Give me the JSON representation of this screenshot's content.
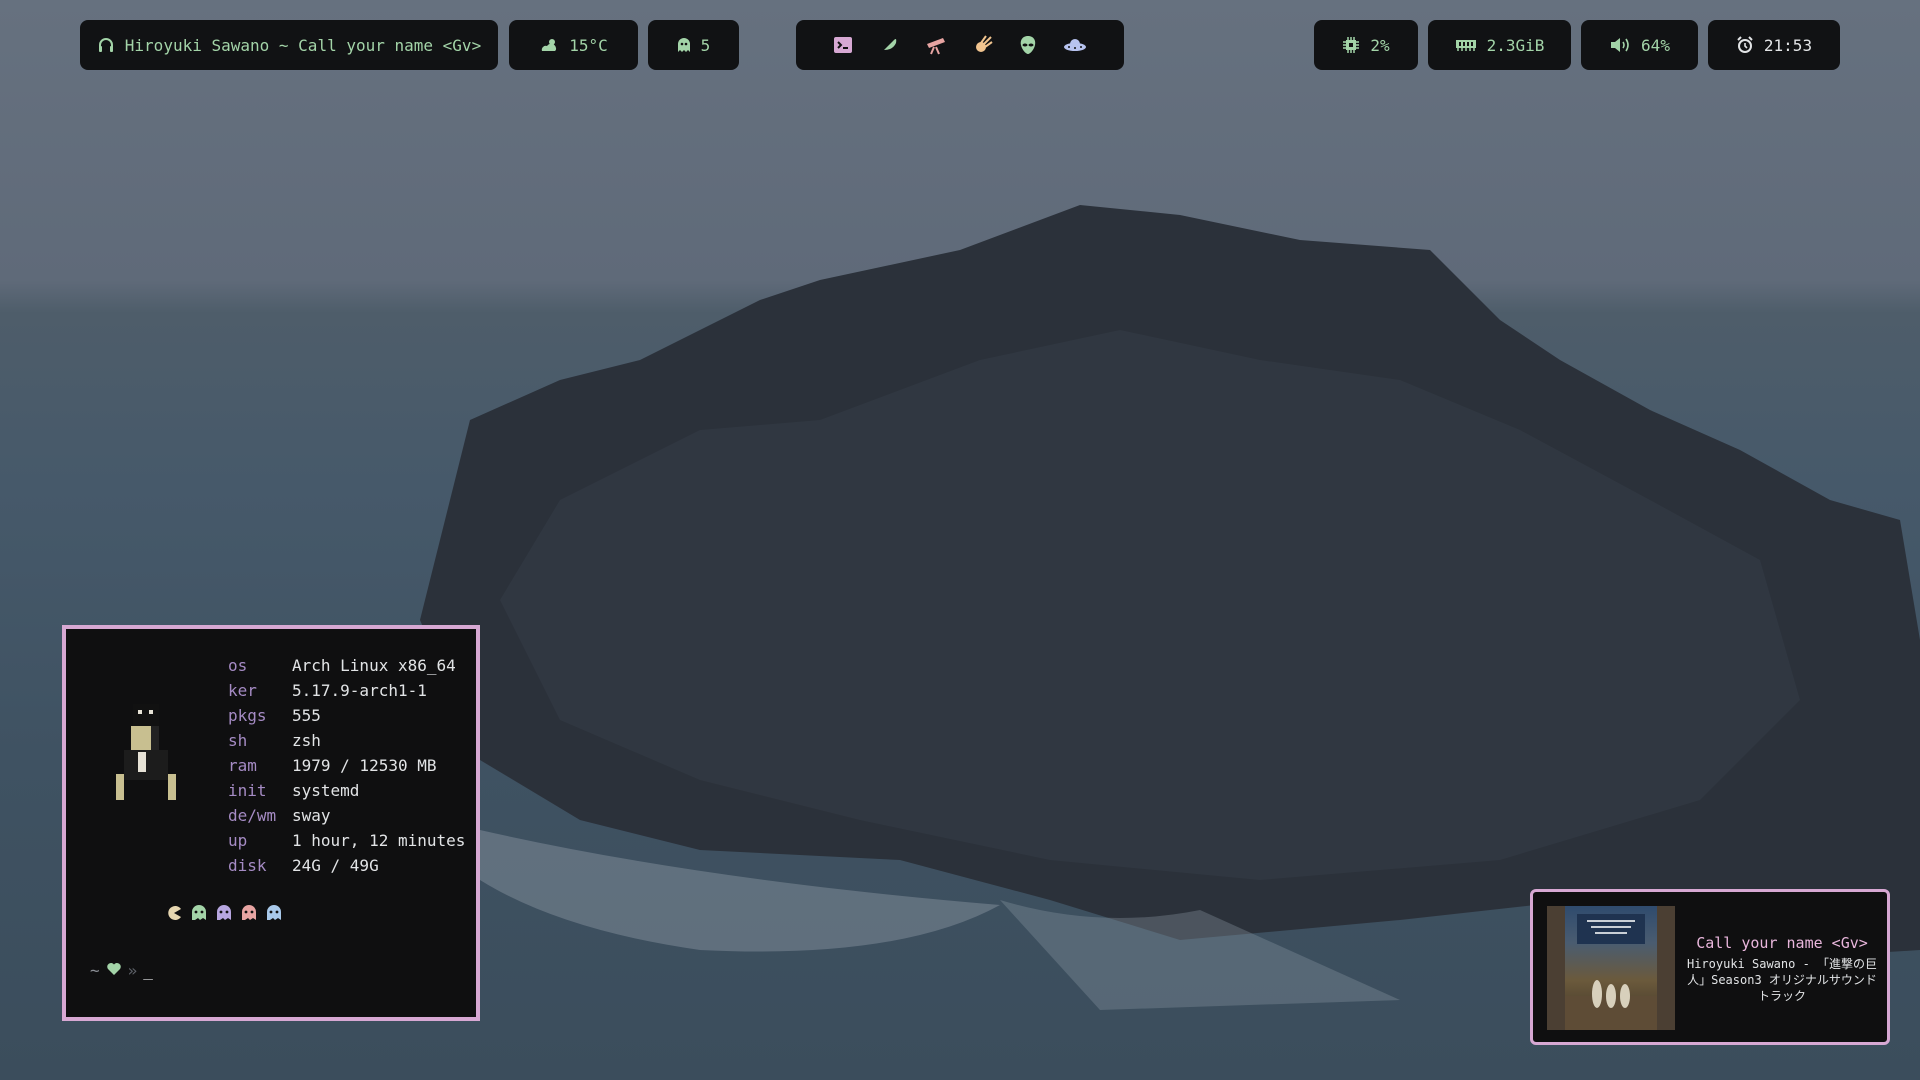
{
  "topbar": {
    "music": {
      "icon": "headphones-icon",
      "label": "Hiroyuki Sawano ~ Call your name <Gv>"
    },
    "weather": {
      "icon": "cloud-sun-icon",
      "label": "15°C"
    },
    "notifications": {
      "icon": "ghost-icon",
      "label": "5"
    },
    "workspaces": [
      {
        "icon": "terminal-icon"
      },
      {
        "icon": "feather-icon"
      },
      {
        "icon": "telescope-icon"
      },
      {
        "icon": "meteor-icon"
      },
      {
        "icon": "alien-icon"
      },
      {
        "icon": "ufo-icon"
      }
    ],
    "cpu": {
      "icon": "cpu-chip-icon",
      "label": "2%"
    },
    "memory": {
      "icon": "memory-icon",
      "label": "2.3GiB"
    },
    "volume": {
      "icon": "speaker-icon",
      "label": "64%"
    },
    "clock": {
      "icon": "alarm-clock-icon",
      "label": "21:53"
    }
  },
  "terminal": {
    "fetch": [
      {
        "key": "os",
        "value": "Arch Linux x86_64"
      },
      {
        "key": "ker",
        "value": "5.17.9-arch1-1"
      },
      {
        "key": "pkgs",
        "value": "555"
      },
      {
        "key": "sh",
        "value": "zsh"
      },
      {
        "key": "ram",
        "value": "1979 / 12530 MB"
      },
      {
        "key": "init",
        "value": "systemd"
      },
      {
        "key": "de/wm",
        "value": "sway"
      },
      {
        "key": "up",
        "value": "1 hour, 12 minutes"
      },
      {
        "key": "disk",
        "value": "24G / 49G"
      }
    ],
    "prompt": {
      "tilde": "~",
      "arrows": "»",
      "cursor": "_"
    }
  },
  "now_playing": {
    "title": "Call your name <Gv>",
    "subtitle": "Hiroyuki Sawano - 「進撃の巨人」Season3 オリジナルサウンドトラック"
  },
  "colors": {
    "bar_bg": "#111214",
    "accent_pink": "#d7a8d3",
    "text_green": "#a3d4a8",
    "key_purple": "#a58bc4"
  }
}
